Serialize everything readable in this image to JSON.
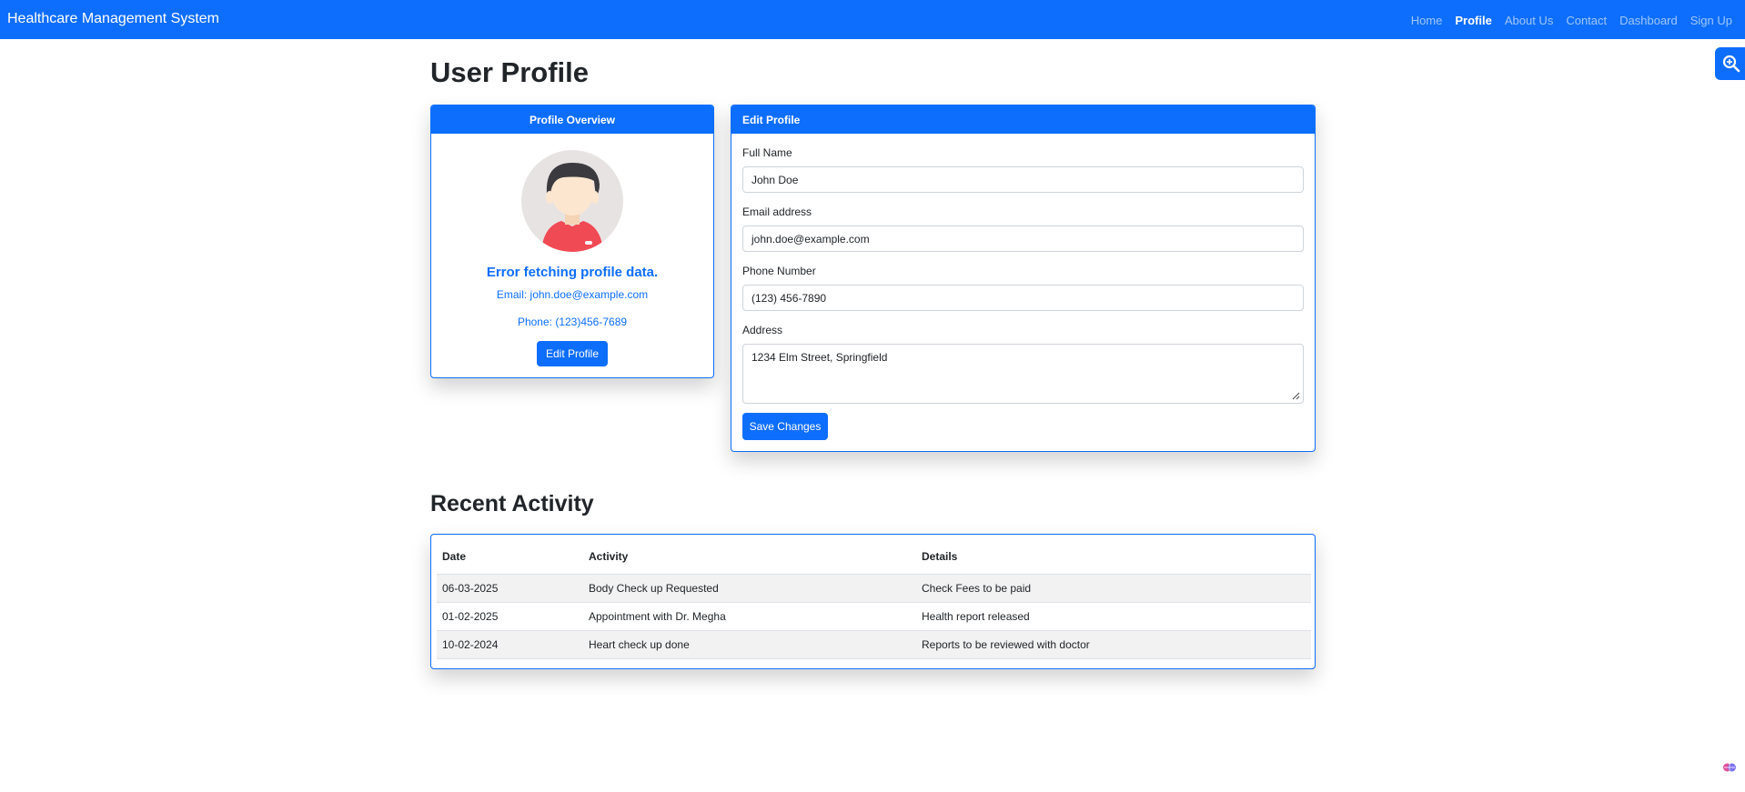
{
  "navbar": {
    "brand": "Healthcare Management System",
    "links": [
      "Home",
      "Profile",
      "About Us",
      "Contact",
      "Dashboard",
      "Sign Up"
    ],
    "active_link": "Profile"
  },
  "page": {
    "title": "User Profile"
  },
  "overview": {
    "header": "Profile Overview",
    "error": "Error fetching profile data.",
    "email": "Email: john.doe@example.com",
    "phone": "Phone: (123)456-7689",
    "edit_button": "Edit Profile"
  },
  "edit_profile": {
    "header": "Edit Profile",
    "full_name_label": "Full Name",
    "full_name_value": "John Doe",
    "email_label": "Email address",
    "email_value": "john.doe@example.com",
    "phone_label": "Phone Number",
    "phone_value": "(123) 456-7890",
    "address_label": "Address",
    "address_value": "1234 Elm Street, Springfield",
    "save_button": "Save Changes"
  },
  "activity": {
    "title": "Recent Activity",
    "columns": [
      "Date",
      "Activity",
      "Details"
    ],
    "rows": [
      [
        "06-03-2025",
        "Body Check up Requested",
        "Check Fees to be paid"
      ],
      [
        "01-02-2025",
        "Appointment with Dr. Megha",
        "Health report released"
      ],
      [
        "10-02-2024",
        "Heart check up done",
        "Reports to be reviewed with doctor"
      ]
    ]
  },
  "icons": {
    "fab": "zoom-search-icon",
    "corner": "extension-icon",
    "avatar": "user-avatar"
  },
  "colors": {
    "primary": "#0d6efd",
    "text": "#212529",
    "stripe": "#f2f2f2"
  }
}
